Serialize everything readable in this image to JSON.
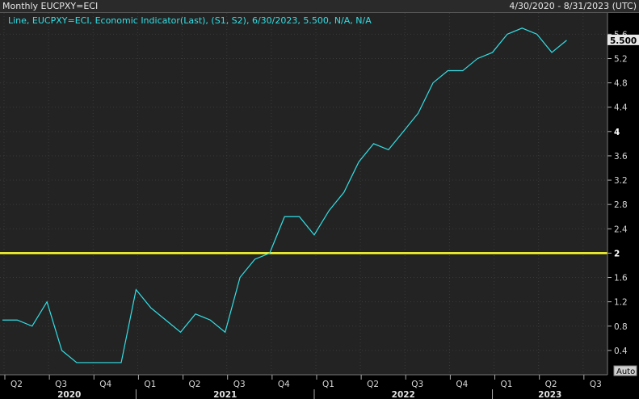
{
  "header": {
    "title": "Monthly EUCPXY=ECI",
    "date_range": "4/30/2020 - 8/31/2023 (UTC)"
  },
  "legend": {
    "text": "Line, EUCPXY=ECI, Economic Indicator(Last), (S1, S2), 6/30/2023, 5.500, N/A, N/A"
  },
  "auto_button": "Auto",
  "colors": {
    "background": "#232323",
    "line": "#33e0e6",
    "reference_line": "#ffff33",
    "grid": "#3a3a3a"
  },
  "chart_data": {
    "type": "line",
    "title": "",
    "x": [
      "2020-04",
      "2020-05",
      "2020-06",
      "2020-07",
      "2020-08",
      "2020-09",
      "2020-10",
      "2020-11",
      "2020-12",
      "2021-01",
      "2021-02",
      "2021-03",
      "2021-04",
      "2021-05",
      "2021-06",
      "2021-07",
      "2021-08",
      "2021-09",
      "2021-10",
      "2021-11",
      "2021-12",
      "2022-01",
      "2022-02",
      "2022-03",
      "2022-04",
      "2022-05",
      "2022-06",
      "2022-07",
      "2022-08",
      "2022-09",
      "2022-10",
      "2022-11",
      "2022-12",
      "2023-01",
      "2023-02",
      "2023-03",
      "2023-04",
      "2023-05",
      "2023-06"
    ],
    "series": [
      {
        "values": [
          0.9,
          0.9,
          0.8,
          1.2,
          0.4,
          0.2,
          0.2,
          0.2,
          0.2,
          1.4,
          1.1,
          0.9,
          0.7,
          1.0,
          0.9,
          0.7,
          1.6,
          1.9,
          2.0,
          2.6,
          2.6,
          2.3,
          2.7,
          3.0,
          3.5,
          3.8,
          3.7,
          4.0,
          4.3,
          4.8,
          5.0,
          5.0,
          5.2,
          5.3,
          5.6,
          5.7,
          5.6,
          5.3,
          5.5
        ]
      }
    ],
    "last_value_label": "5.500",
    "reference_line": 2,
    "y_ticks": [
      "0.4",
      "0.8",
      "1.2",
      "1.6",
      "2",
      "2.4",
      "2.8",
      "3.2",
      "3.6",
      "4",
      "4.4",
      "4.8",
      "5.2",
      "5.6"
    ],
    "ylim": [
      0,
      5.95
    ],
    "quarter_labels": [
      "Q2",
      "Q3",
      "Q4",
      "Q1",
      "Q2",
      "Q3",
      "Q4",
      "Q1",
      "Q2",
      "Q3",
      "Q4",
      "Q1",
      "Q2",
      "Q3"
    ],
    "year_labels": [
      "2020",
      "2021",
      "2022",
      "2023"
    ],
    "grid": true
  }
}
